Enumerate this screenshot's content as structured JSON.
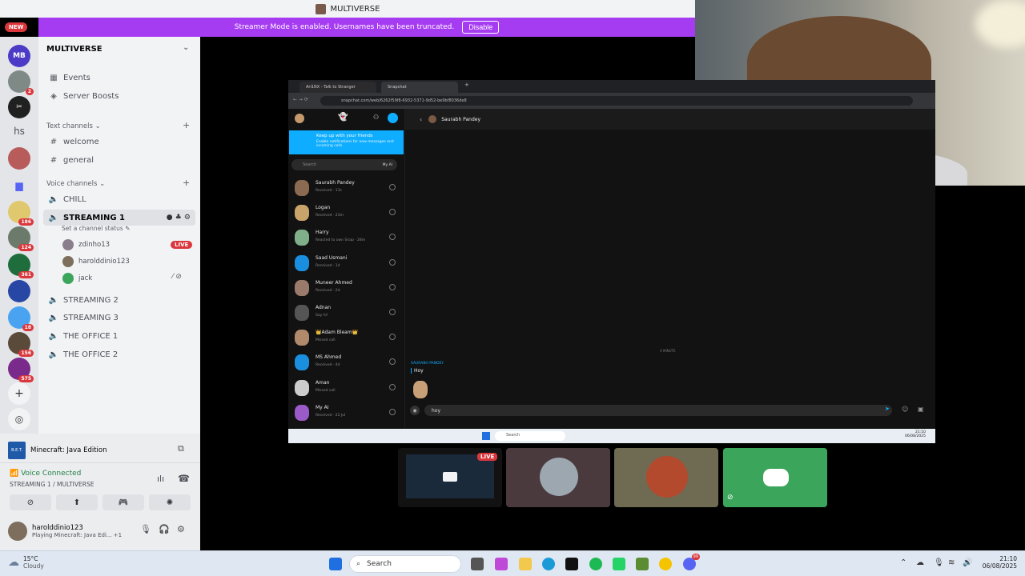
{
  "window": {
    "title": "MULTIVERSE"
  },
  "new_badge": "NEW",
  "banner": {
    "text": "Streamer Mode is enabled. Usernames have been truncated.",
    "disable_label": "Disable"
  },
  "guild_rail": {
    "badges": [
      "2",
      "186",
      "124",
      "361",
      "18",
      "156",
      "575"
    ],
    "texts": [
      "hs"
    ]
  },
  "server": {
    "name": "MULTIVERSE"
  },
  "nav": [
    {
      "label": "Events",
      "icon": "calendar-icon"
    },
    {
      "label": "Server Boosts",
      "icon": "boost-icon"
    }
  ],
  "text_category": "Text channels",
  "text_channels": [
    "welcome",
    "general"
  ],
  "voice_category": "Voice channels",
  "voice_channels_top": [
    "CHILL"
  ],
  "active_channel": {
    "name": "STREAMING 1",
    "status": "Set a channel status"
  },
  "voice_users": [
    {
      "name": "zdinho13",
      "live": "LIVE"
    },
    {
      "name": "harolddinio123"
    },
    {
      "name": "jack"
    }
  ],
  "voice_channels_bottom": [
    "STREAMING 2",
    "STREAMING 3",
    "THE OFFICE 1",
    "THE OFFICE 2"
  ],
  "rich_presence": {
    "game": "Minecraft: Java Edition",
    "icon_text": "B.E.T."
  },
  "voice": {
    "status": "Voice Connected",
    "location": "STREAMING 1 / MULTIVERSE"
  },
  "me": {
    "name": "harolddinio123",
    "activity": "Playing Minecraft: Java Edi... +1"
  },
  "snapchat": {
    "tabs": [
      "Ari1NX - Talk to Stranger",
      "Snapchat"
    ],
    "url": "snapchat.com/web/6262f59f8-6932-5371-9d52-be9bf8036de8",
    "banner_title": "Keep up with your friends",
    "banner_body": "Enable notifications for new messages and incoming calls",
    "search_placeholder": "Search",
    "my_ai": "My AI",
    "contacts": [
      {
        "name": "Saurabh Pandey",
        "status": "Received · 13s"
      },
      {
        "name": "Logan",
        "status": "Received · 23m"
      },
      {
        "name": "Harry",
        "status": "Reacted to own Snap · 28m"
      },
      {
        "name": "Saad Usmani",
        "status": "Received · 1d"
      },
      {
        "name": "Muneer Ahmed",
        "status": "Received · 2d"
      },
      {
        "name": "Adnan",
        "status": "Say hi!"
      },
      {
        "name": "👑Adam Bleam👑",
        "status": "Missed call"
      },
      {
        "name": "MS Ahmed",
        "status": "Received · 4d"
      },
      {
        "name": "Aman",
        "status": "Missed call"
      },
      {
        "name": "My AI",
        "status": "Received · 22 Jul"
      }
    ],
    "chat_name": "Saurabh Pandey",
    "timestamp": "A MINUTE",
    "msg_sender": "SAURABH PANDEY",
    "msg_text": "Hoy",
    "compose_text": "hoy",
    "inner_clock": "21:10",
    "inner_date": "06/08/2025",
    "inner_search": "Search"
  },
  "tiles": [
    {
      "live": "LIVE"
    }
  ],
  "taskbar": {
    "temp": "15°C",
    "weather": "Cloudy",
    "search": "Search",
    "time": "21:10",
    "date": "06/08/2025",
    "chat_badge": "99"
  },
  "colors": {
    "brand": "#a63cf2",
    "live_red": "#da373c",
    "discord_green": "#3ba55c",
    "snap_blue": "#0fadff"
  }
}
